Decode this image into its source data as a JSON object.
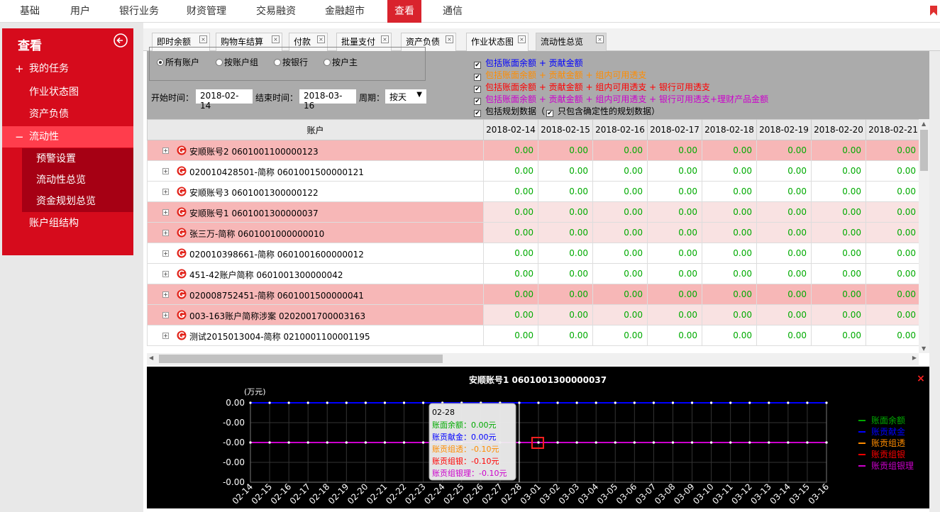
{
  "topnav": {
    "items": [
      {
        "label": "基础",
        "active": false
      },
      {
        "label": "用户",
        "active": false
      },
      {
        "label": "银行业务",
        "active": false
      },
      {
        "label": "财资管理",
        "active": false
      },
      {
        "label": "交易融资",
        "active": false
      },
      {
        "label": "金融超市",
        "active": false
      },
      {
        "label": "查看",
        "active": true
      },
      {
        "label": "通信",
        "active": false
      }
    ]
  },
  "sidebar": {
    "title": "查看",
    "items": [
      {
        "label": "我的任务",
        "prefix": "+"
      },
      {
        "label": "作业状态图",
        "prefix": ""
      },
      {
        "label": "资产负债",
        "prefix": ""
      },
      {
        "label": "流动性",
        "prefix": "−",
        "active": true
      }
    ],
    "subitems": [
      "预警设置",
      "流动性总览",
      "资金规划总览"
    ],
    "after": "账户组结构"
  },
  "tabs": [
    {
      "label": "即时余额"
    },
    {
      "label": "购物车结算"
    },
    {
      "label": "付款"
    },
    {
      "label": "批量支付"
    },
    {
      "label": "资产负债"
    },
    {
      "label": "作业状态图"
    },
    {
      "label": "流动性总览",
      "active": true
    }
  ],
  "filter": {
    "radios": [
      {
        "label": "所有账户",
        "checked": true
      },
      {
        "label": "按账户组"
      },
      {
        "label": "按银行"
      },
      {
        "label": "按户主"
      }
    ],
    "start_label": "开始时间：",
    "start_value": "2018-02-14",
    "end_label": "结束时间：",
    "end_value": "2018-03-16",
    "period_label": "周期：",
    "period_value": "按天",
    "checks": [
      {
        "label": "包括账面余额 + 贡献金额",
        "color": "#0000ff"
      },
      {
        "label": "包括账面余额 + 贡献金额 + 组内可用透支",
        "color": "#ff8c00"
      },
      {
        "label": "包括账面余额 + 贡献金额 + 组内可用透支 + 银行可用透支",
        "color": "#ff0000"
      },
      {
        "label": "包括账面余额 + 贡献金额 + 组内可用透支 + 银行可用透支+理财产品金额",
        "color": "#cc00cc"
      }
    ],
    "plan_label": "包括规划数据（",
    "plan_inner": "只包含确定性的规划数据）"
  },
  "grid": {
    "account_header": "账户",
    "dates": [
      "2018-02-14",
      "2018-02-15",
      "2018-02-16",
      "2018-02-17",
      "2018-02-18",
      "2018-02-19",
      "2018-02-20",
      "2018-02-21"
    ],
    "rows": [
      {
        "name": "安顺账号2 0601001100000123",
        "style": "pink2"
      },
      {
        "name": "020010428501-简称 0601001500000121",
        "style": ""
      },
      {
        "name": "安顺账号3 0601001300000122",
        "style": ""
      },
      {
        "name": "安顺账号1 0601001300000037",
        "style": "pink"
      },
      {
        "name": "张三万-简称 0601001000000010",
        "style": "pink"
      },
      {
        "name": "020010398661-简称 0601001600000012",
        "style": ""
      },
      {
        "name": "451-42账户简称 0601001300000042",
        "style": ""
      },
      {
        "name": "020008752451-简称 0601001500000041",
        "style": "pink2"
      },
      {
        "name": "003-163账户简称涉案 0202001700003163",
        "style": "pink"
      },
      {
        "name": "测试2015013004-简称 0210001100001195",
        "style": ""
      }
    ],
    "cell_value": "0.00"
  },
  "chart_data": {
    "type": "line",
    "title": "安顺账号1 0601001300000037",
    "ylabel": "(万元)",
    "x": [
      "02-14",
      "02-15",
      "02-16",
      "02-17",
      "02-18",
      "02-19",
      "02-20",
      "02-21",
      "02-22",
      "02-23",
      "02-24",
      "02-25",
      "02-26",
      "02-27",
      "02-28",
      "03-01",
      "03-02",
      "03-03",
      "03-04",
      "03-05",
      "03-06",
      "03-07",
      "03-08",
      "03-09",
      "03-10",
      "03-11",
      "03-12",
      "03-13",
      "03-14",
      "03-15",
      "03-16"
    ],
    "yticks": [
      "0.00",
      "-0.00",
      "-0.00",
      "-0.00",
      "-0.00"
    ],
    "series": [
      {
        "name": "账面余额",
        "color": "#00aa00",
        "value": 0.0
      },
      {
        "name": "账贡献金",
        "color": "#0000ff",
        "value": 0.0
      },
      {
        "name": "账贡组透",
        "color": "#ff8c00",
        "value": -0.1
      },
      {
        "name": "账贡组银",
        "color": "#ff0000",
        "value": -0.1
      },
      {
        "name": "账贡组银理",
        "color": "#cc00cc",
        "value": -0.1
      }
    ],
    "tooltip": {
      "date": "02-28",
      "lines": [
        {
          "text": "账面余额：0.00元",
          "color": "#00aa00"
        },
        {
          "text": "账贡献金：0.00元",
          "color": "#0000ff"
        },
        {
          "text": "账贡组透：-0.10元",
          "color": "#ff8c00"
        },
        {
          "text": "账贡组银：-0.10元",
          "color": "#ff0000"
        },
        {
          "text": "账贡组银理：-0.10元",
          "color": "#cc00cc"
        }
      ]
    }
  }
}
